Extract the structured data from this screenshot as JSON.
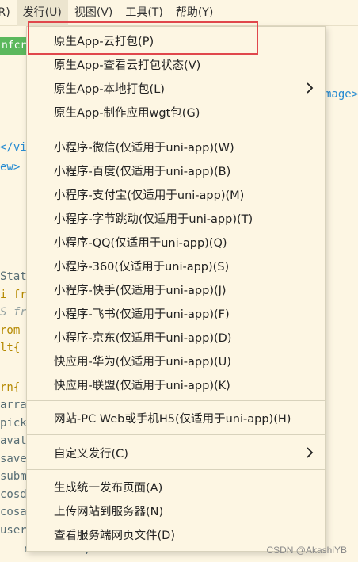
{
  "menubar": {
    "items": [
      {
        "label": "(R)"
      },
      {
        "label": "发行(U)"
      },
      {
        "label": "视图(V)"
      },
      {
        "label": "工具(T)"
      },
      {
        "label": "帮助(Y)"
      }
    ]
  },
  "editor": {
    "lines": [
      {
        "text": "nfcr"
      },
      {
        "text": "mage>"
      },
      {
        "text": "</vi"
      },
      {
        "text": "ew>"
      },
      {
        "text": "Stat"
      },
      {
        "text": "i fr"
      },
      {
        "text": "S fr"
      },
      {
        "text": "rom"
      },
      {
        "text": "lt{"
      },
      {
        "text": "rn{"
      },
      {
        "text": "arra"
      },
      {
        "text": "pick"
      },
      {
        "text": "avat"
      },
      {
        "text": "save"
      },
      {
        "text": "subm"
      },
      {
        "text": "cosd"
      },
      {
        "text": "cosa"
      },
      {
        "text": "user"
      },
      {
        "text": "name:  '',"
      }
    ]
  },
  "dropdown": {
    "groups": [
      [
        {
          "label": "原生App-云打包(P)"
        },
        {
          "label": "原生App-查看云打包状态(V)"
        },
        {
          "label": "原生App-本地打包(L)",
          "submenu": true
        },
        {
          "label": "原生App-制作应用wgt包(G)"
        }
      ],
      [
        {
          "label": "小程序-微信(仅适用于uni-app)(W)"
        },
        {
          "label": "小程序-百度(仅适用于uni-app)(B)"
        },
        {
          "label": "小程序-支付宝(仅适用于uni-app)(M)"
        },
        {
          "label": "小程序-字节跳动(仅适用于uni-app)(T)"
        },
        {
          "label": "小程序-QQ(仅适用于uni-app)(Q)"
        },
        {
          "label": "小程序-360(仅适用于uni-app)(S)"
        },
        {
          "label": "小程序-快手(仅适用于uni-app)(J)"
        },
        {
          "label": "小程序-飞书(仅适用于uni-app)(F)"
        },
        {
          "label": "小程序-京东(仅适用于uni-app)(D)"
        },
        {
          "label": "快应用-华为(仅适用于uni-app)(U)"
        },
        {
          "label": "快应用-联盟(仅适用于uni-app)(K)"
        }
      ],
      [
        {
          "label": "网站-PC Web或手机H5(仅适用于uni-app)(H)"
        }
      ],
      [
        {
          "label": "自定义发行(C)",
          "submenu": true
        }
      ],
      [
        {
          "label": "生成统一发布页面(A)"
        },
        {
          "label": "上传网站到服务器(N)"
        },
        {
          "label": "查看服务端网页文件(D)"
        }
      ]
    ],
    "submenu_arrow": "›"
  },
  "watermark": "CSDN @AkashiYB",
  "colors": {
    "highlight": "#e0474c",
    "menu_bg": "#fdf6e3"
  }
}
